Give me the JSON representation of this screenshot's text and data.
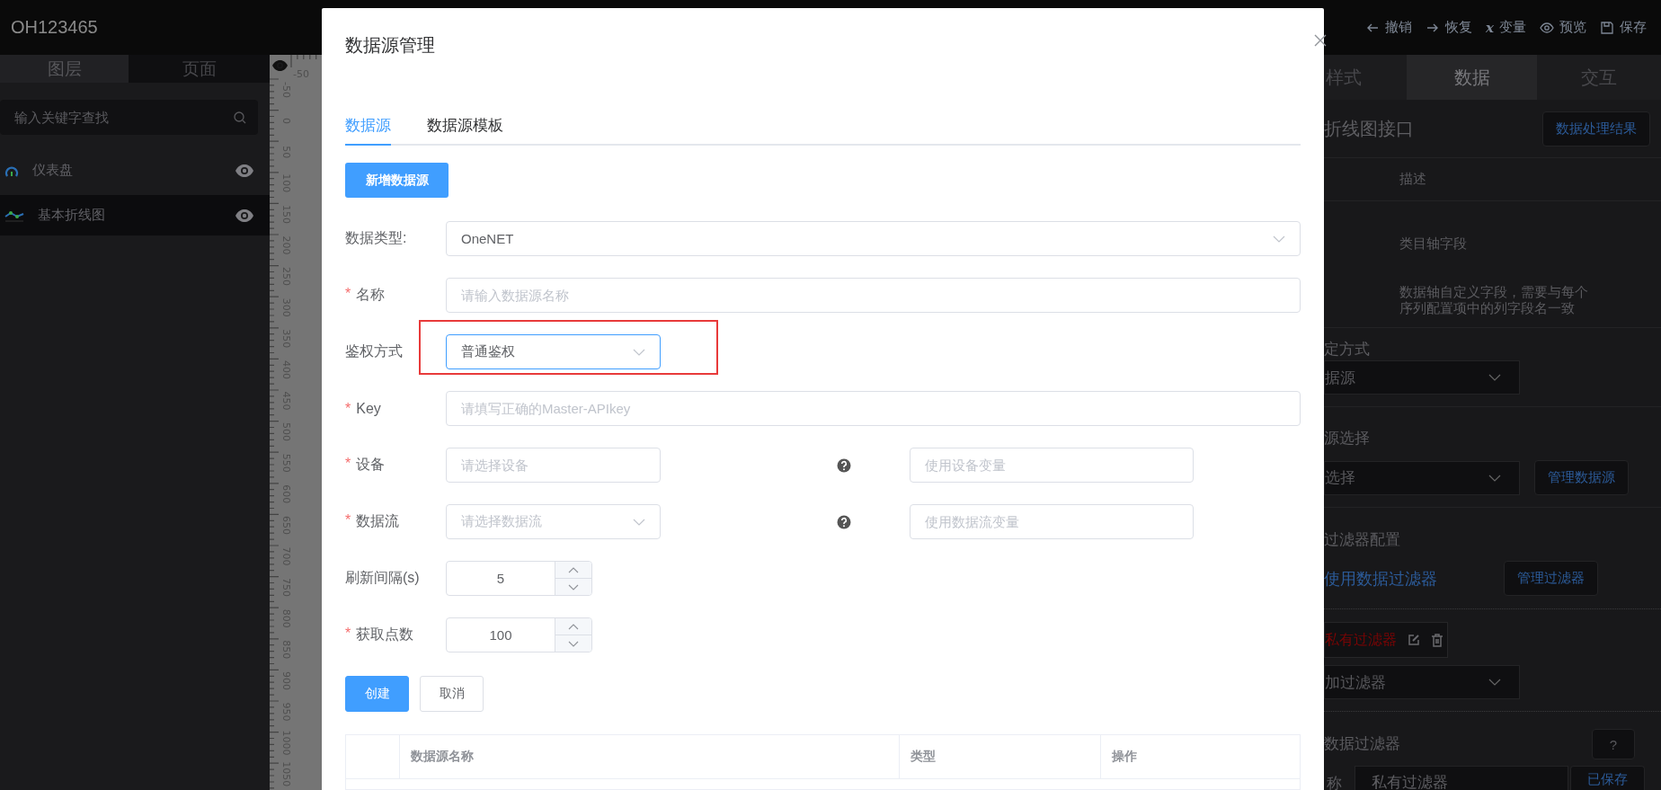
{
  "topbar": {
    "title": "OH123465",
    "actions": [
      {
        "kind": "undo",
        "label": "撤销"
      },
      {
        "kind": "redo",
        "label": "恢复"
      },
      {
        "kind": "variable",
        "icon_text": "x",
        "label": "变量"
      },
      {
        "kind": "preview",
        "label": "预览"
      },
      {
        "kind": "save",
        "label": "保存"
      }
    ]
  },
  "left_panel": {
    "tabs": [
      {
        "label": "图层",
        "selected": true
      },
      {
        "label": "页面",
        "selected": false
      }
    ],
    "search": {
      "placeholder": "输入关键字查找"
    },
    "layers": [
      {
        "name": "仪表盘",
        "kind": "gauge",
        "selected": false
      },
      {
        "name": "基本折线图",
        "kind": "line",
        "selected": true
      }
    ]
  },
  "ruler": {
    "top_labels": [
      "-50"
    ],
    "side_labels": [
      "-50",
      "0",
      "50",
      "100",
      "150",
      "200",
      "250",
      "300",
      "350",
      "400",
      "450",
      "500",
      "550",
      "600",
      "650",
      "700",
      "750",
      "800",
      "850",
      "900",
      "950",
      "1000",
      "1050"
    ]
  },
  "dialog": {
    "title": "数据源管理",
    "tabs": [
      {
        "label": "数据源",
        "selected": true
      },
      {
        "label": "数据源模板",
        "selected": false
      }
    ],
    "add_button": "新增数据源",
    "fields": [
      {
        "kind": "select",
        "label": "数据类型:",
        "value": "OneNET"
      },
      {
        "kind": "text",
        "marker": "*",
        "label": "名称",
        "placeholder": "请输入数据源名称"
      },
      {
        "kind": "short-select",
        "label": "鉴权方式",
        "value": "普通鉴权",
        "focused": true,
        "annotated": true
      },
      {
        "kind": "text",
        "marker": "*",
        "label": "Key",
        "placeholder": "请填写正确的Master-APIkey"
      },
      {
        "kind": "pair",
        "marker": "*",
        "label": "设备",
        "placeholder": "请选择设备",
        "dropdown": false,
        "variable_placeholder": "使用设备变量"
      },
      {
        "kind": "pair",
        "marker": "*",
        "label": "数据流",
        "placeholder": "请选择数据流",
        "dropdown": true,
        "variable_placeholder": "使用数据流变量"
      },
      {
        "kind": "number",
        "label": "刷新间隔(s)",
        "value": "5"
      },
      {
        "kind": "number",
        "marker": "*",
        "label": "获取点数",
        "value": "100"
      }
    ],
    "buttons": [
      {
        "label": "创建",
        "kind": "primary"
      },
      {
        "label": "取消",
        "kind": "default"
      }
    ],
    "table": {
      "columns": [
        "数据源名称",
        "类型",
        "操作"
      ]
    }
  },
  "right_panel": {
    "tabs": [
      {
        "label": "样式",
        "selected": false
      },
      {
        "label": "数据",
        "selected": true
      },
      {
        "label": "交互",
        "selected": false
      }
    ],
    "title": "折线图接口",
    "result_button": "数据处理结果",
    "field_table": {
      "header": "描述",
      "rows": [
        "类目轴字段",
        "数据轴自定义字段，需要与每个序列配置项中的列字段名一致"
      ]
    },
    "binding": {
      "label": "定方式",
      "value": "据源"
    },
    "source": {
      "label": "源选择",
      "value": "选择",
      "button": "管理数据源"
    },
    "filter": {
      "label": "过滤器配置",
      "link": "使用数据过滤器",
      "button": "管理过滤器",
      "tag": "私有过滤器",
      "add_value": "加过滤器"
    },
    "data_filter": {
      "label": "数据过滤器",
      "help": "?",
      "name_label": "称",
      "name_value": "私有过滤器",
      "status_button": "已保存"
    }
  }
}
